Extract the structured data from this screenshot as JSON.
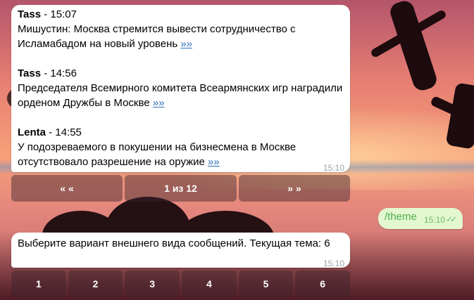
{
  "news": {
    "items": [
      {
        "source": "Tass",
        "time": "15:07",
        "text": "Мишустин: Москва стремится вывести сотрудничество с Исламабадом на новый уровень",
        "more": "»»"
      },
      {
        "source": "Tass",
        "time": "14:56",
        "text": "Председателя Всемирного комитета Всеармянских игр наградили орденом Дружбы в Москве",
        "more": "»»"
      },
      {
        "source": "Lenta",
        "time": "14:55",
        "text": "У подозреваемого в покушении на бизнесмена в Москве отсутствовало разрешение на оружие",
        "more": "»»"
      }
    ],
    "separator": " - ",
    "timestamp": "15:10"
  },
  "pager": {
    "prev_label": "« «",
    "page_label": "1 из 12",
    "next_label": "» »"
  },
  "outgoing": {
    "text": "/theme",
    "timestamp": "15:10",
    "status_icon": "double-check-icon",
    "color": "#4fae4e"
  },
  "theme_message": {
    "text": "Выберите вариант внешнего вида сообщений. Текущая тема: 6",
    "timestamp": "15:10"
  },
  "theme_buttons": [
    "1",
    "2",
    "3",
    "4",
    "5",
    "6"
  ],
  "colors": {
    "link": "#2b6cb8",
    "bubble_in": "#ffffff",
    "bubble_out": "#e3f8d0"
  }
}
